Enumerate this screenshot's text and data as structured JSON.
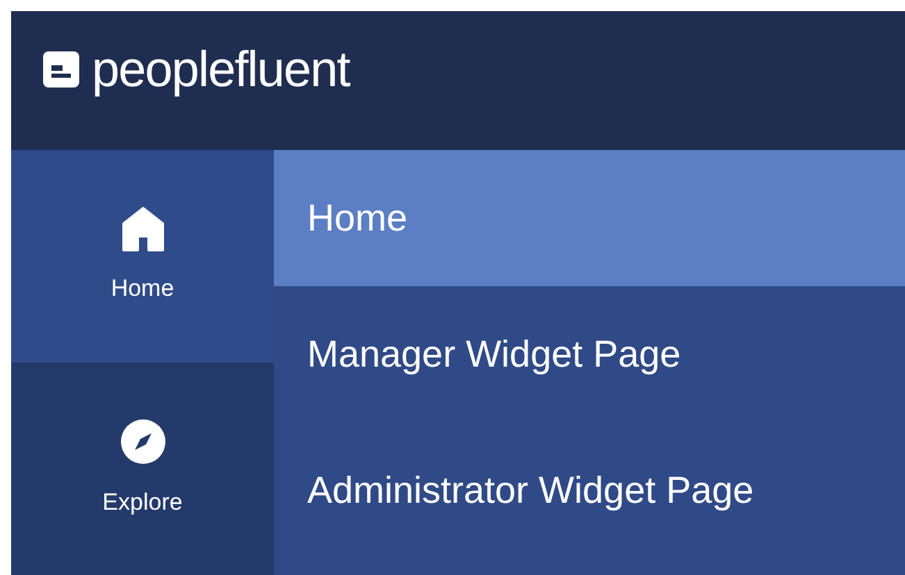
{
  "header": {
    "logo_text": "peoplefluent"
  },
  "rail": [
    {
      "label": "Home",
      "kind": "home",
      "selected": true
    },
    {
      "label": "Explore",
      "kind": "compass",
      "selected": false
    }
  ],
  "menu": [
    {
      "label": "Home",
      "selected": true
    },
    {
      "label": "Manager Widget Page",
      "selected": false
    },
    {
      "label": "Administrator Widget Page",
      "selected": false
    }
  ]
}
